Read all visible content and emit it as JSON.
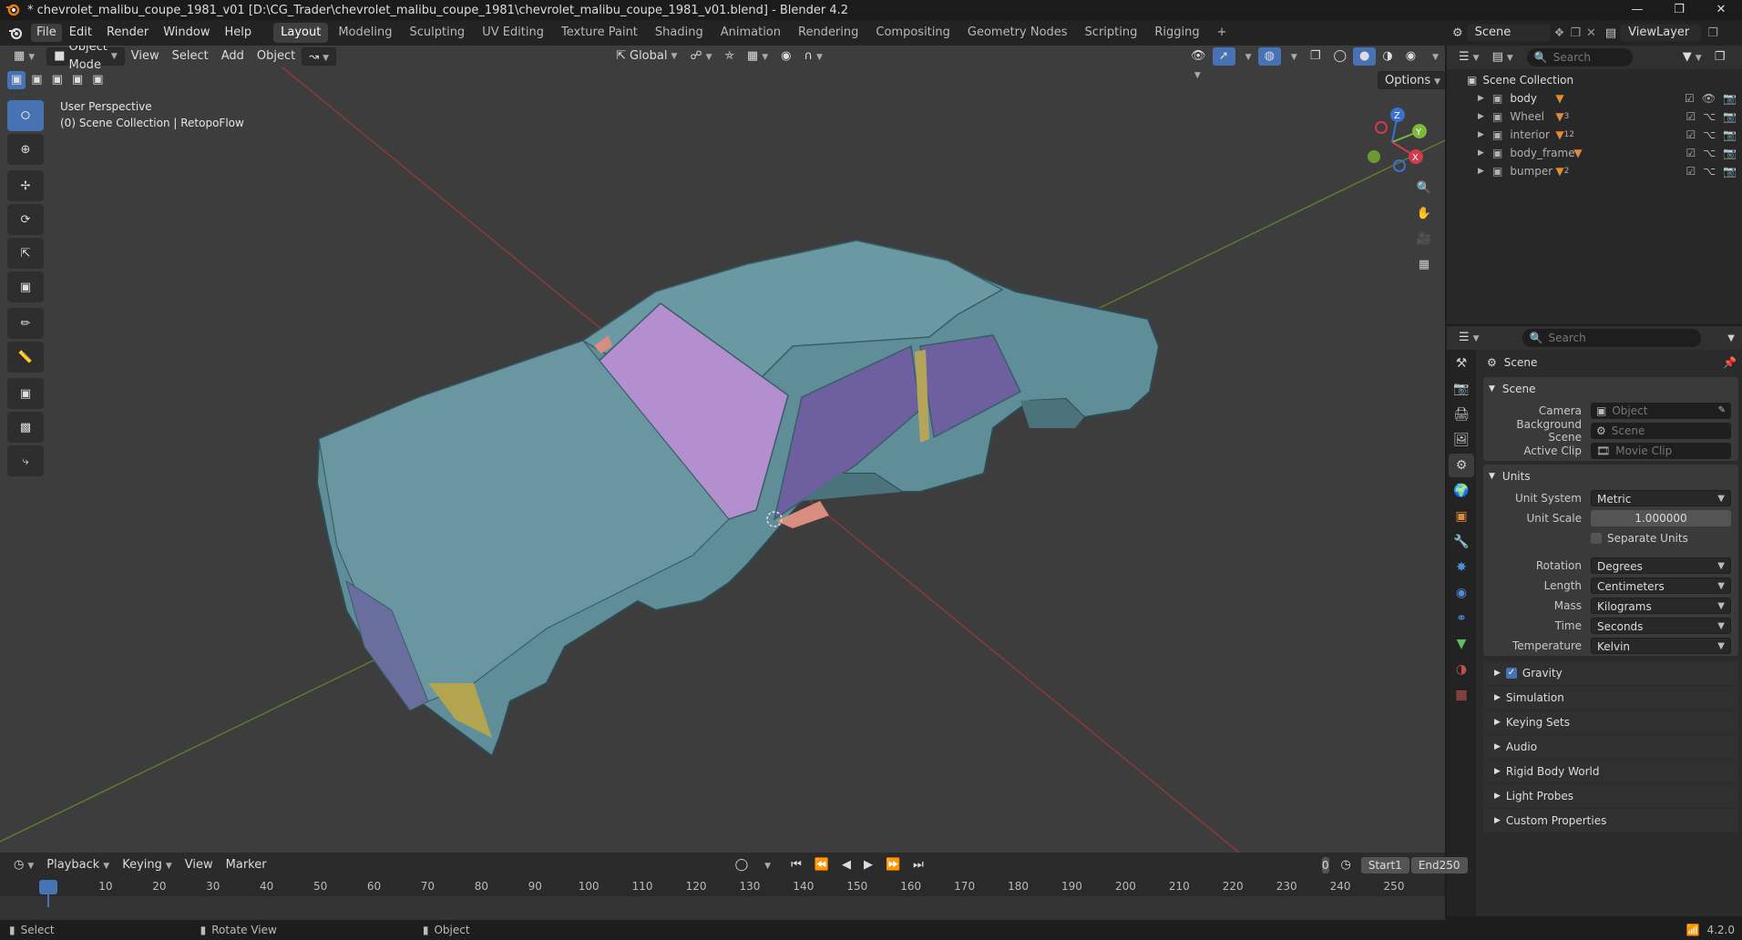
{
  "title": "* chevrolet_malibu_coupe_1981_v01 [D:\\CG_Trader\\chevrolet_malibu_coupe_1981\\chevrolet_malibu_coupe_1981_v01.blend] - Blender 4.2",
  "menus": [
    "File",
    "Edit",
    "Render",
    "Window",
    "Help"
  ],
  "workspaces": [
    "Layout",
    "Modeling",
    "Sculpting",
    "UV Editing",
    "Texture Paint",
    "Shading",
    "Animation",
    "Rendering",
    "Compositing",
    "Geometry Nodes",
    "Scripting",
    "Rigging"
  ],
  "scene_name": "Scene",
  "viewlayer_name": "ViewLayer",
  "viewport": {
    "mode": "Object Mode",
    "menus": [
      "View",
      "Select",
      "Add",
      "Object"
    ],
    "transform": "Global",
    "options": "Options",
    "overlay_line1": "User Perspective",
    "overlay_line2": "(0) Scene Collection | RetopoFlow",
    "axis_x": "X",
    "axis_y": "Y",
    "axis_z": "Z"
  },
  "outliner": {
    "search_placeholder": "Search",
    "collection": "Scene Collection",
    "items": [
      {
        "name": "body",
        "badge": ""
      },
      {
        "name": "Wheel",
        "badge": "3"
      },
      {
        "name": "interior",
        "badge": "12"
      },
      {
        "name": "body_frame",
        "badge": ""
      },
      {
        "name": "bumper",
        "badge": "2"
      }
    ]
  },
  "properties": {
    "search_placeholder": "Search",
    "context": "Scene",
    "scene_panel": "Scene",
    "camera_label": "Camera",
    "camera_value": "Object",
    "bgscene_label": "Background Scene",
    "bgscene_value": "Scene",
    "clip_label": "Active Clip",
    "clip_value": "Movie Clip",
    "units_panel": "Units",
    "unit_system_label": "Unit System",
    "unit_system": "Metric",
    "unit_scale_label": "Unit Scale",
    "unit_scale": "1.000000",
    "separate_units": "Separate Units",
    "rotation_label": "Rotation",
    "rotation": "Degrees",
    "length_label": "Length",
    "length": "Centimeters",
    "mass_label": "Mass",
    "mass": "Kilograms",
    "time_label": "Time",
    "time": "Seconds",
    "temperature_label": "Temperature",
    "temperature": "Kelvin",
    "subpanels": [
      "Gravity",
      "Simulation",
      "Keying Sets",
      "Audio",
      "Rigid Body World",
      "Light Probes",
      "Custom Properties"
    ]
  },
  "timeline": {
    "menus": [
      "Playback",
      "Keying",
      "View",
      "Marker"
    ],
    "current_frame": "0",
    "start_label": "Start",
    "start": "1",
    "end_label": "End",
    "end": "250",
    "ticks": [
      "0",
      "10",
      "20",
      "30",
      "40",
      "50",
      "60",
      "70",
      "80",
      "90",
      "100",
      "110",
      "120",
      "130",
      "140",
      "150",
      "160",
      "170",
      "180",
      "190",
      "200",
      "210",
      "220",
      "230",
      "240",
      "250"
    ]
  },
  "statusbar": {
    "select": "Select",
    "rotate": "Rotate View",
    "object": "Object",
    "version": "4.2.0"
  }
}
